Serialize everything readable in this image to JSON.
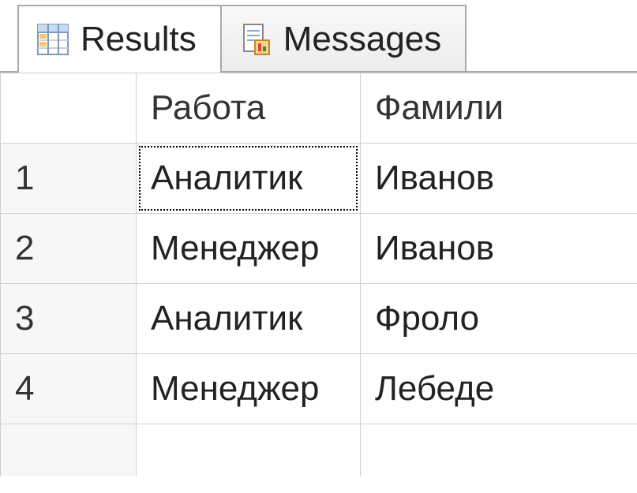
{
  "tabs": {
    "results": {
      "label": "Results",
      "active": true
    },
    "messages": {
      "label": "Messages",
      "active": false
    }
  },
  "grid": {
    "columns": [
      "Работа",
      "Фамили"
    ],
    "rows": [
      {
        "n": "1",
        "c0": "Аналитик",
        "c1": "Иванов"
      },
      {
        "n": "2",
        "c0": "Менеджер",
        "c1": "Иванов"
      },
      {
        "n": "3",
        "c0": "Аналитик",
        "c1": "Фроло"
      },
      {
        "n": "4",
        "c0": "Менеджер",
        "c1": "Лебеде"
      }
    ],
    "focused": {
      "row": 0,
      "col": 0
    }
  }
}
